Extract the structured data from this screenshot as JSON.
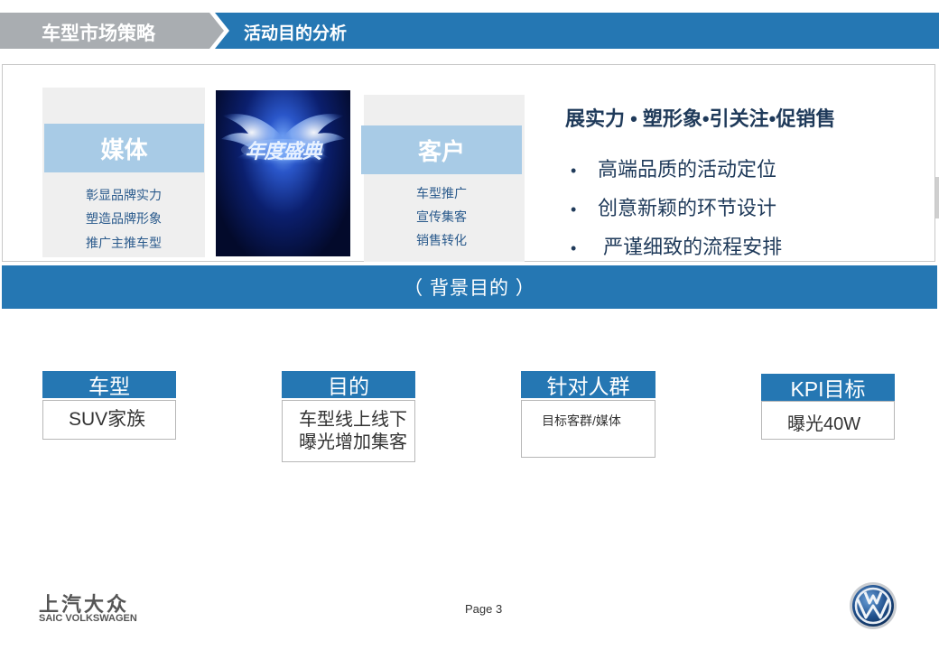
{
  "header": {
    "section": "车型市场策略",
    "title": "活动目的分析"
  },
  "media_card": {
    "title": "媒体",
    "lines": [
      "彰显品牌实力",
      "塑造品牌形象",
      "推广主推车型"
    ]
  },
  "poster": {
    "text": "年度盛典",
    "colors": {
      "glow": "#7fb2ff",
      "deep": "#030a2b"
    }
  },
  "customer_card": {
    "title": "客户",
    "lines": [
      "车型推广",
      "宣传集客",
      "销售转化"
    ]
  },
  "slogan": "展实力 • 塑形象•引关注•促销售",
  "bullets": [
    {
      "dot": "•",
      "text": "高端品质的活动定位"
    },
    {
      "dot": "•",
      "text": "创意新颖的环节设计"
    },
    {
      "dot": "•",
      "text": " 严谨细致的流程安排"
    }
  ],
  "background_band": "（  背景目的 ）",
  "boxes": [
    {
      "head": "车型",
      "body_lines": [
        "SUV家族"
      ]
    },
    {
      "head": "目的",
      "body_lines": [
        "车型线上线下",
        "曝光增加集客"
      ]
    },
    {
      "head": "针对人群",
      "body_lines": [
        "目标客群/媒体"
      ]
    },
    {
      "head": "KPI目标",
      "body_lines": [
        "曝光40W"
      ]
    }
  ],
  "footer": {
    "logo_cn": "上汽大众",
    "logo_en": "SAIC VOLKSWAGEN",
    "page": "Page 3"
  },
  "colors": {
    "primary_blue": "#2577b3",
    "light_blue": "#a8cbe6",
    "gray": "#a9adb1"
  }
}
